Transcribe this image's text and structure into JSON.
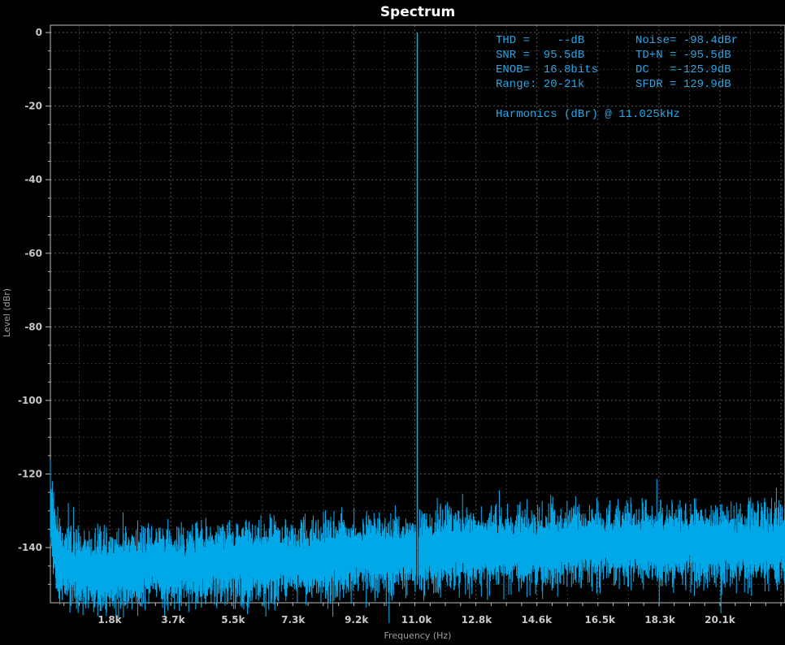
{
  "chart_data": {
    "type": "line",
    "title": "Spectrum",
    "xlabel": "Frequency (Hz)",
    "ylabel": "Level (dBr)",
    "xlim": [
      20,
      22050
    ],
    "ylim": [
      -155,
      2
    ],
    "x_ticks": [
      {
        "value": 1800,
        "label": "1.8k"
      },
      {
        "value": 3700,
        "label": "3.7k"
      },
      {
        "value": 5500,
        "label": "5.5k"
      },
      {
        "value": 7300,
        "label": "7.3k"
      },
      {
        "value": 9200,
        "label": "9.2k"
      },
      {
        "value": 11000,
        "label": "11.0k"
      },
      {
        "value": 12800,
        "label": "12.8k"
      },
      {
        "value": 14600,
        "label": "14.6k"
      },
      {
        "value": 16500,
        "label": "16.5k"
      },
      {
        "value": 18300,
        "label": "18.3k"
      },
      {
        "value": 20100,
        "label": "20.1k"
      }
    ],
    "y_ticks": [
      {
        "value": 0,
        "label": "0"
      },
      {
        "value": -20,
        "label": "-20"
      },
      {
        "value": -40,
        "label": "-40"
      },
      {
        "value": -60,
        "label": "-60"
      },
      {
        "value": -80,
        "label": "-80"
      },
      {
        "value": -100,
        "label": "-100"
      },
      {
        "value": -120,
        "label": "-120"
      },
      {
        "value": -140,
        "label": "-140"
      }
    ],
    "grid": true,
    "series": [
      {
        "color": "#00a8e8",
        "fundamental_hz": 11025,
        "fundamental_level": 0,
        "x": [
          20,
          200,
          400,
          700,
          1000,
          1500,
          2000,
          3000,
          4000,
          5000,
          6000,
          7000,
          8000,
          9000,
          10000,
          10800,
          11025,
          11300,
          12000,
          13000,
          14000,
          15000,
          16000,
          17000,
          18000,
          19000,
          20000,
          21000,
          22050
        ],
        "y": [
          -130,
          -141,
          -144,
          -145,
          -146,
          -146,
          -146,
          -145,
          -145,
          -144,
          -144,
          -143,
          -143,
          -142,
          -142,
          -141,
          0,
          -141,
          -140,
          -140,
          -140,
          -140,
          -139,
          -139,
          -139,
          -139,
          -139,
          -139,
          -139
        ]
      }
    ]
  },
  "annotations": [
    {
      "text": "THD =    --dB",
      "color": "#2aa6e6"
    },
    {
      "text": "Noise= -98.4dBr",
      "color": "#2aa6e6"
    },
    {
      "text": "SNR =  95.5dB",
      "color": "#2aa6e6"
    },
    {
      "text": "TD+N = -95.5dB",
      "color": "#2aa6e6"
    },
    {
      "text": "ENOB=  16.8bits",
      "color": "#2aa6e6"
    },
    {
      "text": "DC   =-125.9dB",
      "color": "#2aa6e6"
    },
    {
      "text": "Range: 20-21k",
      "color": "#2aa6e6"
    },
    {
      "text": "SFDR = 129.9dB",
      "color": "#2aa6e6"
    },
    {
      "text": "Harmonics (dBr) @ 11.025kHz",
      "color": "#2aa6e6"
    }
  ]
}
